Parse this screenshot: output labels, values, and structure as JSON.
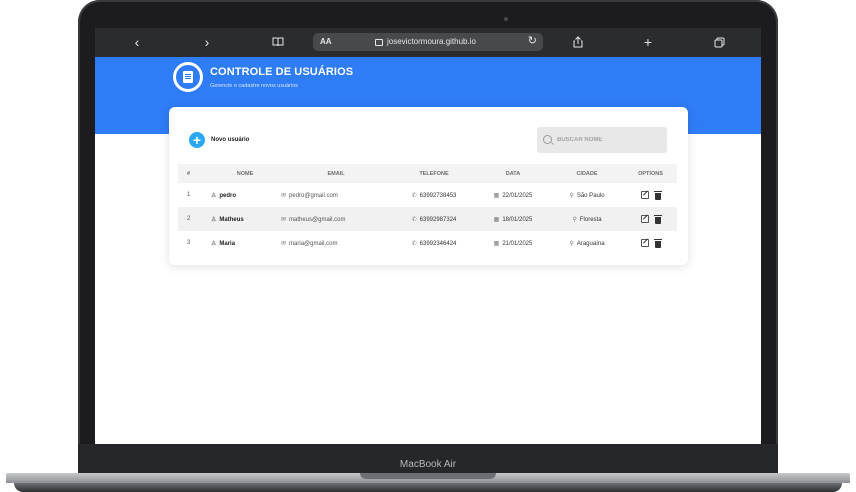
{
  "device": {
    "label": "MacBook Air"
  },
  "browser": {
    "aa_label": "AA",
    "url": "josevictormoura.github.io",
    "icons": [
      "chevron-left-icon",
      "chevron-right-icon",
      "book-icon",
      "lock-icon",
      "reload-icon",
      "share-icon",
      "plus-icon",
      "tabs-icon"
    ]
  },
  "app": {
    "title": "CONTROLE DE USUÁRIOS",
    "subtitle": "Gerencie e cadastre novos usuários",
    "accent": "#2e7cf6"
  },
  "toolbar": {
    "new_user_label": "Novo usuário",
    "search_placeholder": "BUSCAR NOME"
  },
  "table": {
    "headers": [
      "#",
      "NOME",
      "EMAIL",
      "TELEFONE",
      "DATA",
      "CIDADE",
      "OPTIONS"
    ],
    "rows": [
      {
        "id": "1",
        "name": "pedro",
        "email": "pedro@gmail.com",
        "phone": "63992738453",
        "date": "22/01/2025",
        "city": "São Paulo"
      },
      {
        "id": "2",
        "name": "Matheus",
        "email": "matheus@gmail.com",
        "phone": "63992987324",
        "date": "18/01/2025",
        "city": "Floresta"
      },
      {
        "id": "3",
        "name": "Maria",
        "email": "maria@gmail.com",
        "phone": "63992346424",
        "date": "21/01/2025",
        "city": "Araguaína"
      }
    ]
  }
}
